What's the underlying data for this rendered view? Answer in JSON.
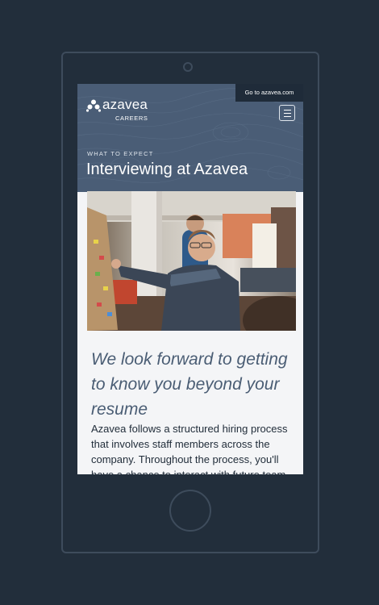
{
  "header": {
    "external_link": "Go to azavea.com",
    "logo_text": "azavea",
    "logo_subtext": "CAREERS",
    "menu_icon": "hamburger-menu-icon"
  },
  "hero": {
    "eyebrow": "WHAT TO EXPECT",
    "title": "Interviewing at Azavea"
  },
  "content": {
    "subheading": "We look forward to getting to know you beyond your resume",
    "body": "Azavea follows a structured hiring process that involves staff members across the company. Throughout the process, you'll have a chance to interact with future team"
  },
  "colors": {
    "background": "#222e3b",
    "hero": "#4a5d76",
    "link_bar": "#1f2b39",
    "subheading": "#4a5d74"
  }
}
